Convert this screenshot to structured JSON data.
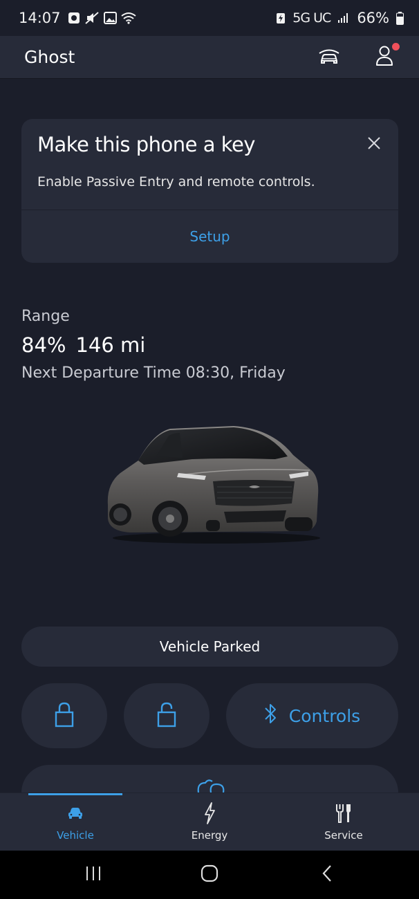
{
  "status_bar": {
    "time": "14:07",
    "network": "5G UC",
    "battery": "66%"
  },
  "header": {
    "title": "Ghost",
    "icons": [
      "garage-icon",
      "profile-icon"
    ],
    "notification_color": "#f0505b"
  },
  "key_card": {
    "title": "Make this phone a key",
    "description": "Enable Passive Entry and remote controls.",
    "action": "Setup"
  },
  "vehicle": {
    "range_label": "Range",
    "battery_percent": "84%",
    "range_miles": "146 mi",
    "departure": "Next Departure Time 08:30, Friday",
    "status": "Vehicle Parked"
  },
  "controls": {
    "lock_icon": "lock-icon",
    "unlock_icon": "unlock-icon",
    "controls_label": "Controls",
    "controls_icon": "bluetooth-icon"
  },
  "tabs": [
    {
      "label": "Vehicle",
      "icon": "car-icon",
      "active": true
    },
    {
      "label": "Energy",
      "icon": "bolt-icon",
      "active": false
    },
    {
      "label": "Service",
      "icon": "tools-icon",
      "active": false
    }
  ],
  "colors": {
    "accent": "#3da0e8",
    "background": "#1b1e2a",
    "card": "#272b39"
  }
}
